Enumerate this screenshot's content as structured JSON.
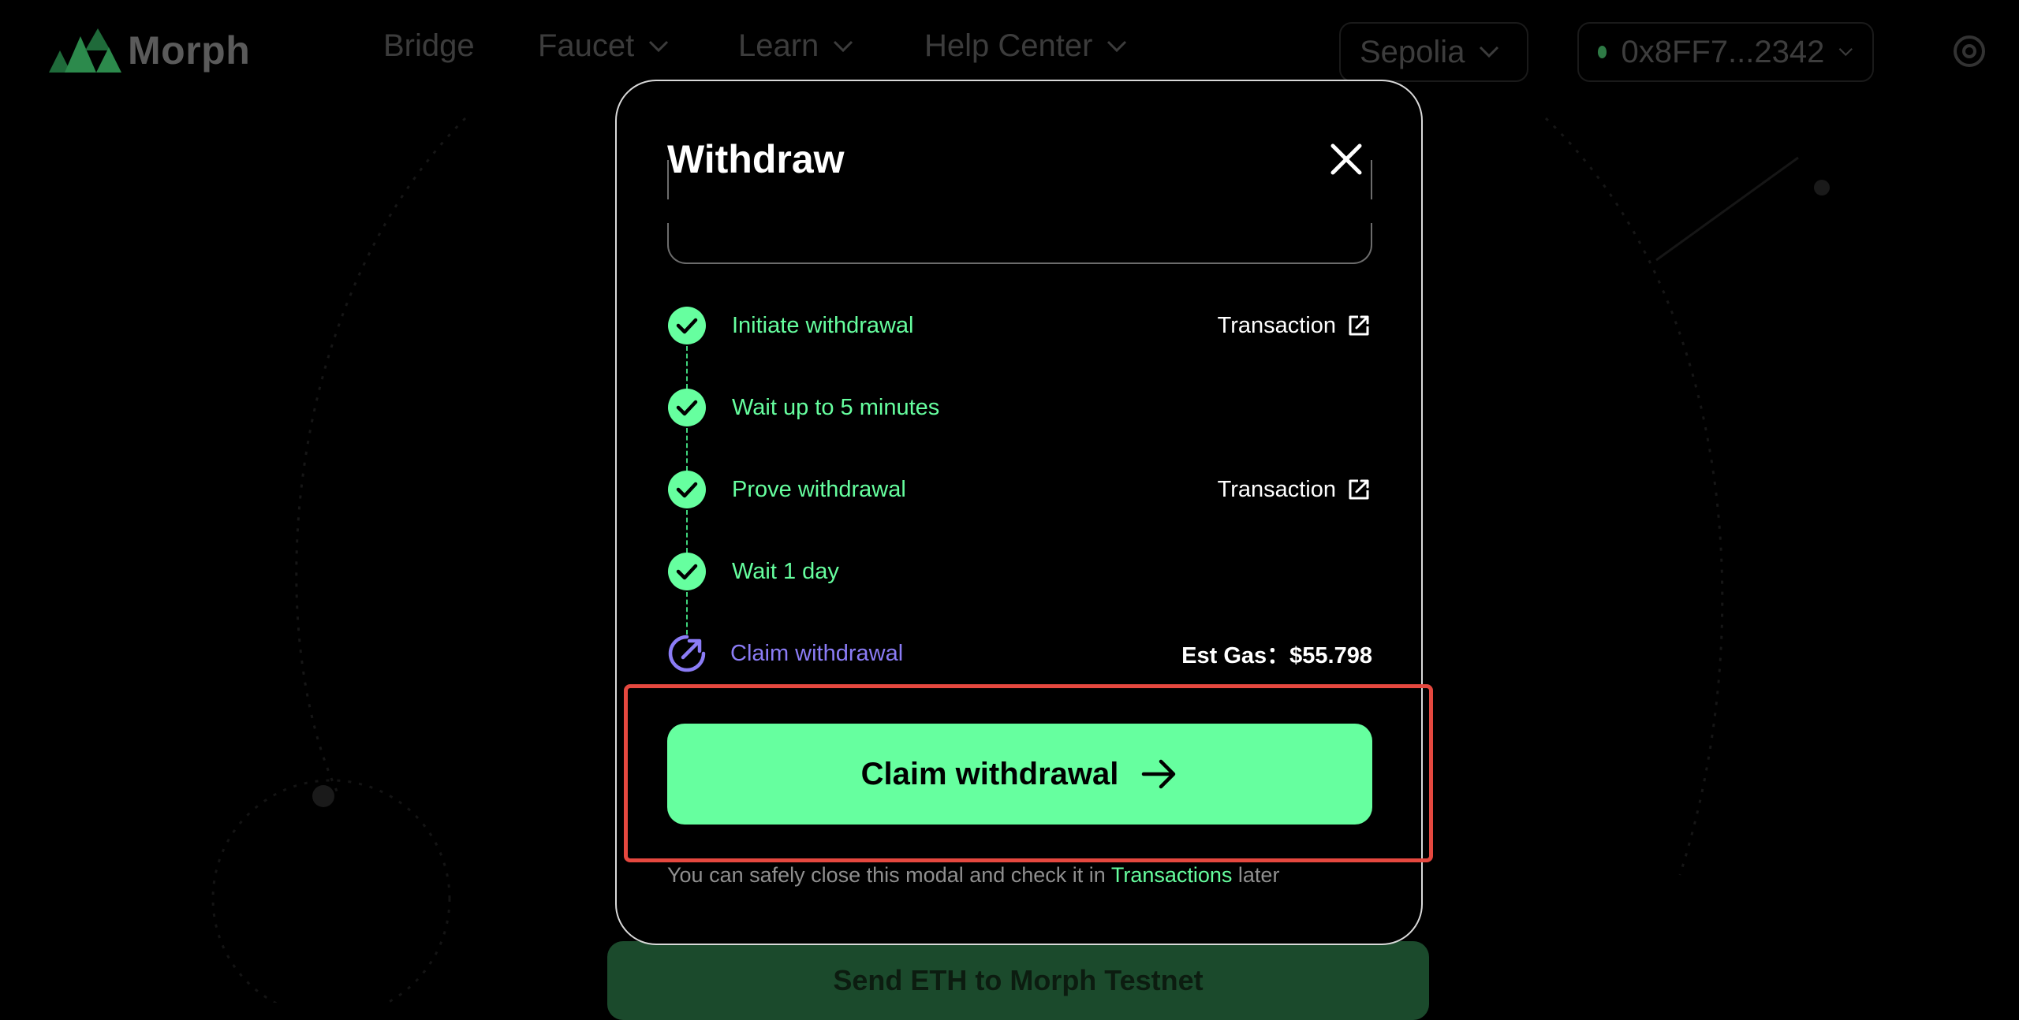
{
  "background": {
    "logo_text": "Morph",
    "nav": [
      {
        "label": "Bridge",
        "has_dropdown": false
      },
      {
        "label": "Faucet",
        "has_dropdown": true
      },
      {
        "label": "Learn",
        "has_dropdown": true
      },
      {
        "label": "Help Center",
        "has_dropdown": true
      }
    ],
    "network": "Sepolia",
    "wallet": "0x8FF7...2342",
    "bottom_button": "Send ETH to Morph Testnet"
  },
  "modal": {
    "title": "Withdraw",
    "steps": [
      {
        "label": "Initiate withdrawal",
        "status": "done",
        "link": "Transaction"
      },
      {
        "label": "Wait up to 5 minutes",
        "status": "done"
      },
      {
        "label": "Prove withdrawal",
        "status": "done",
        "link": "Transaction"
      },
      {
        "label": "Wait 1 day",
        "status": "done"
      },
      {
        "label": "Claim withdrawal",
        "status": "pending"
      }
    ],
    "est_gas_label": "Est Gas：",
    "est_gas_value": "$55.798",
    "claim_button": "Claim withdrawal",
    "footnote_before": "You can safely close this modal and check it in ",
    "footnote_link": "Transactions",
    "footnote_after": " later"
  },
  "colors": {
    "accent_green": "#66ff9f",
    "pending_purple": "#8b7cf6",
    "highlight_red": "#e5483f"
  }
}
